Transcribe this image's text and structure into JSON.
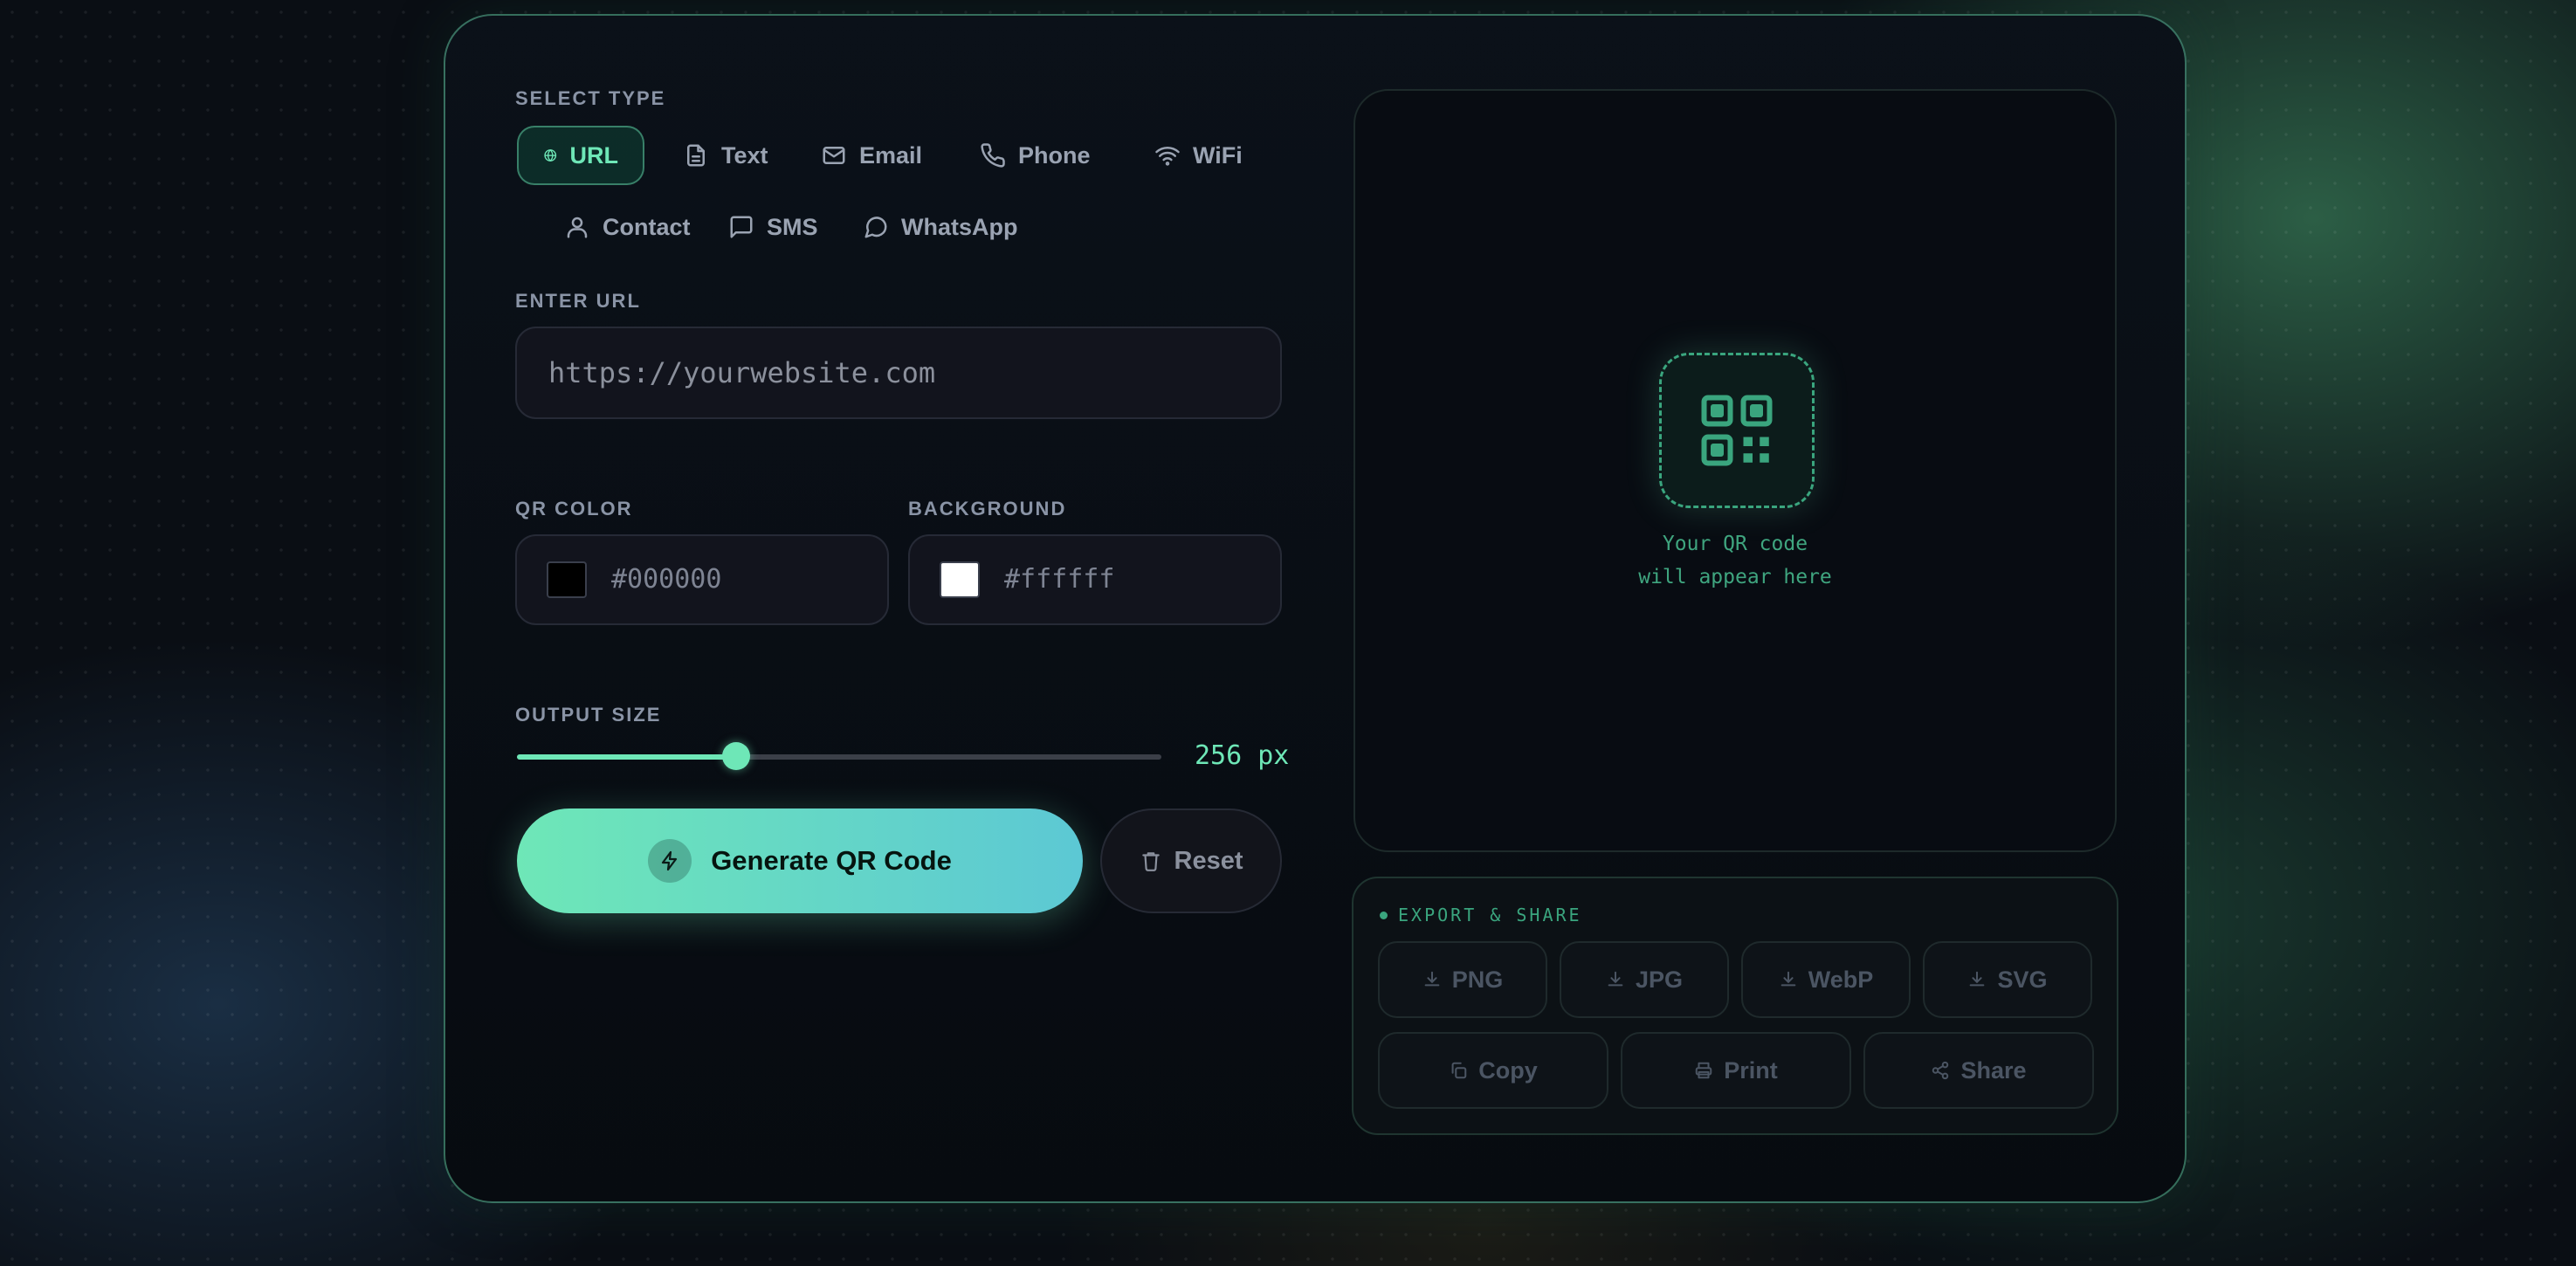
{
  "select_type": {
    "label": "SELECT TYPE",
    "options": [
      {
        "label": "URL",
        "icon": "globe-icon"
      },
      {
        "label": "Text",
        "icon": "document-icon"
      },
      {
        "label": "Email",
        "icon": "mail-icon"
      },
      {
        "label": "Phone",
        "icon": "phone-icon"
      },
      {
        "label": "WiFi",
        "icon": "wifi-icon"
      },
      {
        "label": "Contact",
        "icon": "user-icon"
      },
      {
        "label": "SMS",
        "icon": "message-icon"
      },
      {
        "label": "WhatsApp",
        "icon": "chat-bubble-icon"
      }
    ],
    "selected": "URL"
  },
  "url_input": {
    "label": "ENTER URL",
    "placeholder": "https://yourwebsite.com",
    "value": ""
  },
  "qr_color": {
    "label": "QR COLOR",
    "value": "#000000",
    "swatch": "#000000"
  },
  "background": {
    "label": "BACKGROUND",
    "value": "#ffffff",
    "swatch": "#ffffff"
  },
  "output_size": {
    "label": "OUTPUT SIZE",
    "value_text": "256 px",
    "value": 256,
    "fraction": 0.34
  },
  "actions": {
    "generate_label": "Generate QR Code",
    "reset_label": "Reset"
  },
  "preview": {
    "line1": "Your QR code",
    "line2": "will appear here"
  },
  "export": {
    "title": "EXPORT & SHARE",
    "formats": [
      "PNG",
      "JPG",
      "WebP",
      "SVG"
    ],
    "copy_label": "Copy",
    "print_label": "Print",
    "share_label": "Share"
  },
  "colors": {
    "accent": "#6ee7b7",
    "accent2": "#5cc8d4",
    "background": "#0a0e14"
  }
}
